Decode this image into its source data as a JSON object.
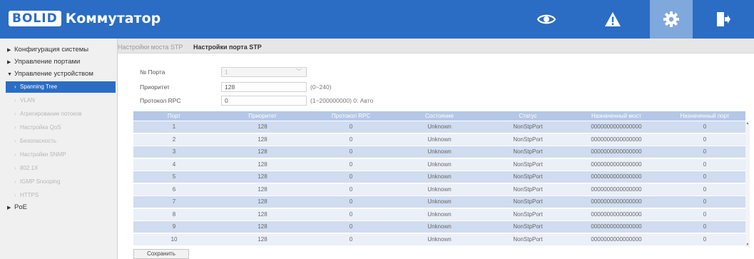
{
  "header": {
    "logo_box": "BOLID",
    "logo_text": "Коммутатор",
    "icons": [
      "eye-icon",
      "warning-icon",
      "gear-icon",
      "logout-icon"
    ],
    "active_icon": "gear-icon",
    "colors": {
      "bar": "#2b6cc4",
      "active_icon_bg": "#7fa8dc"
    }
  },
  "sidebar": {
    "items": [
      {
        "label": "Конфигурация системы",
        "level": 0,
        "expanded": false
      },
      {
        "label": "Управление портами",
        "level": 0,
        "expanded": false
      },
      {
        "label": "Управление устройством",
        "level": 0,
        "expanded": true
      },
      {
        "label": "Spanning Tree",
        "level": 1,
        "active": true
      },
      {
        "label": "VLAN",
        "level": 1
      },
      {
        "label": "Агрегирование потоков",
        "level": 1
      },
      {
        "label": "Настройка QoS",
        "level": 1
      },
      {
        "label": "Безопасность",
        "level": 1
      },
      {
        "label": "Настройки SNMP",
        "level": 1
      },
      {
        "label": "802.1X",
        "level": 1
      },
      {
        "label": "IGMP Snooping",
        "level": 1
      },
      {
        "label": "HTTPS",
        "level": 1
      },
      {
        "label": "PoE",
        "level": 0,
        "expanded": false
      }
    ]
  },
  "tabs": [
    {
      "label": "Настройки моста STP",
      "active": false
    },
    {
      "label": "Настройки порта STP",
      "active": true
    }
  ],
  "form": {
    "port_label": "№ Порта",
    "port_value": "1",
    "priority_label": "Приоритет",
    "priority_value": "128",
    "priority_hint": "(0~240)",
    "rpc_label": "Протокол RPC",
    "rpc_value": "0",
    "rpc_hint": "(1~200000000) 0: Авто"
  },
  "table": {
    "columns": [
      "Порт",
      "Приоритет",
      "Протокол RPC",
      "Состояние",
      "Статус",
      "Назначенный мост",
      "Назначенный порт"
    ],
    "rows": [
      [
        "1",
        "128",
        "0",
        "Unknown",
        "NonStpPort",
        "0000000000000000",
        "0"
      ],
      [
        "2",
        "128",
        "0",
        "Unknown",
        "NonStpPort",
        "0000000000000000",
        "0"
      ],
      [
        "3",
        "128",
        "0",
        "Unknown",
        "NonStpPort",
        "0000000000000000",
        "0"
      ],
      [
        "4",
        "128",
        "0",
        "Unknown",
        "NonStpPort",
        "0000000000000000",
        "0"
      ],
      [
        "5",
        "128",
        "0",
        "Unknown",
        "NonStpPort",
        "0000000000000000",
        "0"
      ],
      [
        "6",
        "128",
        "0",
        "Unknown",
        "NonStpPort",
        "0000000000000000",
        "0"
      ],
      [
        "7",
        "128",
        "0",
        "Unknown",
        "NonStpPort",
        "0000000000000000",
        "0"
      ],
      [
        "8",
        "128",
        "0",
        "Unknown",
        "NonStpPort",
        "0000000000000000",
        "0"
      ],
      [
        "9",
        "128",
        "0",
        "Unknown",
        "NonStpPort",
        "0000000000000000",
        "0"
      ],
      [
        "10",
        "128",
        "0",
        "Unknown",
        "NonStpPort",
        "0000000000000000",
        "0"
      ]
    ]
  },
  "save_label": "Сохранить"
}
